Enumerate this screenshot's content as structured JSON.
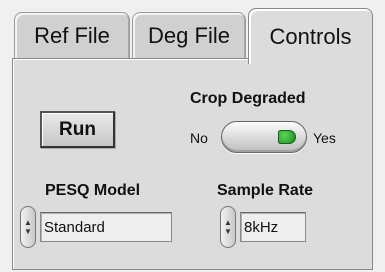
{
  "tabs": [
    {
      "label": "Ref File",
      "active": false
    },
    {
      "label": "Deg File",
      "active": false
    },
    {
      "label": "Controls",
      "active": true
    }
  ],
  "controls": {
    "run_label": "Run",
    "crop_label": "Crop Degraded",
    "crop_off_label": "No",
    "crop_on_label": "Yes",
    "crop_value": "Yes",
    "pesq_label": "PESQ Model",
    "pesq_value": "Standard",
    "rate_label": "Sample Rate",
    "rate_value": "8kHz"
  },
  "colors": {
    "indicator_green": "#2db52d",
    "panel_bg": "#dcdcdc"
  }
}
